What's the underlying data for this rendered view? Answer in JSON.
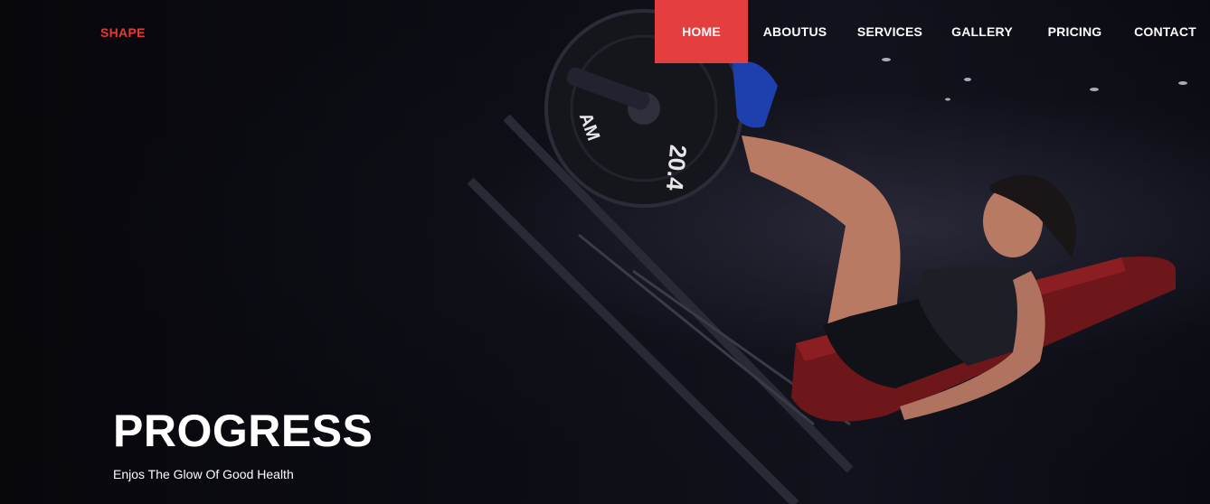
{
  "brand": {
    "logo": "SHAPE"
  },
  "nav": {
    "items": [
      {
        "label": "HOME",
        "active": true
      },
      {
        "label": "ABOUTUS",
        "active": false
      },
      {
        "label": "SERVICES",
        "active": false
      },
      {
        "label": "GALLERY",
        "active": false
      },
      {
        "label": "PRICING",
        "active": false
      },
      {
        "label": "CONTACT",
        "active": false
      }
    ]
  },
  "hero": {
    "title": "PROGRESS",
    "subtitle": "Enjos The Glow Of Good Health",
    "plate_text": "20.4",
    "plate_brand": "AM"
  },
  "colors": {
    "accent": "#e53e3e",
    "logo": "#e53935",
    "background": "#0b0b12",
    "seat": "#7a1a1e"
  }
}
